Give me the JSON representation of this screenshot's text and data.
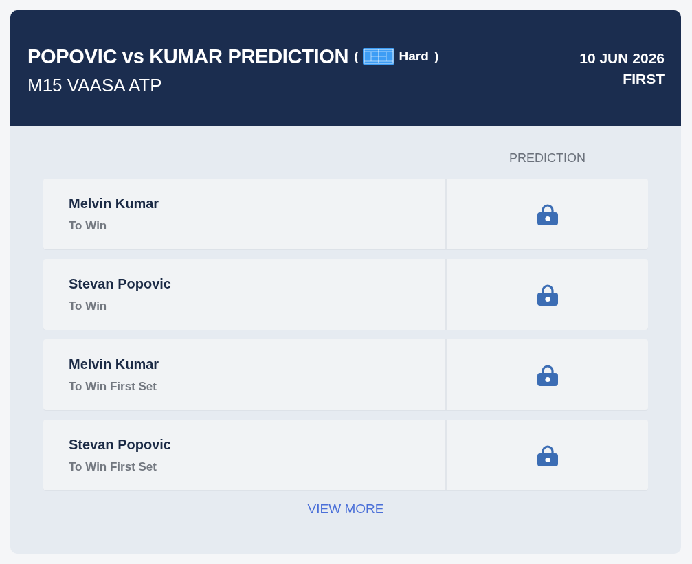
{
  "header": {
    "title": "POPOVIC vs KUMAR PREDICTION",
    "surface": {
      "open": "(",
      "label": "Hard",
      "close": ")"
    },
    "tournament": "M15 VAASA ATP",
    "date": "10 JUN 2026",
    "round": "FIRST"
  },
  "table": {
    "column_heading": "PREDICTION",
    "rows": [
      {
        "player": "Melvin Kumar",
        "market": "To Win",
        "locked": true
      },
      {
        "player": "Stevan Popovic",
        "market": "To Win",
        "locked": true
      },
      {
        "player": "Melvin Kumar",
        "market": "To Win First Set",
        "locked": true
      },
      {
        "player": "Stevan Popovic",
        "market": "To Win First Set",
        "locked": true
      }
    ]
  },
  "view_more": "VIEW MORE"
}
